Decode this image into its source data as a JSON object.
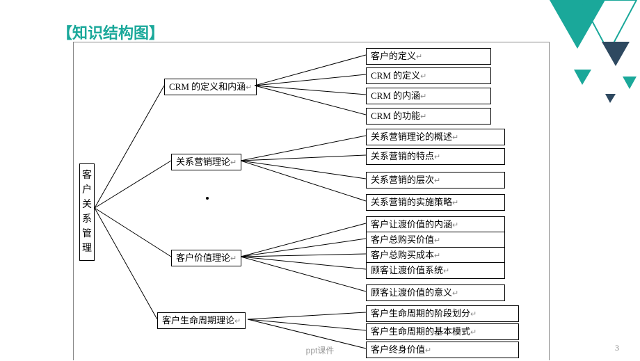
{
  "title": "【知识结构图】",
  "root": "客户关系管理",
  "branches": [
    {
      "label": "CRM 的定义和内涵",
      "leaves": [
        "客户的定义",
        "CRM 的定义",
        "CRM 的内涵",
        "CRM 的功能"
      ]
    },
    {
      "label": "关系营销理论",
      "leaves": [
        "关系营销理论的概述",
        "关系营销的特点",
        "关系营销的层次",
        "关系营销的实施策略"
      ]
    },
    {
      "label": "客户价值理论",
      "leaves": [
        "客户让渡价值的内涵",
        "客户总购买价值",
        "客户总购买成本",
        "顾客让渡价值系统",
        "顾客让渡价值的意义"
      ]
    },
    {
      "label": "客户生命周期理论",
      "leaves": [
        "客户生命周期的阶段划分",
        "客户生命周期的基本模式",
        "客户终身价值"
      ]
    }
  ],
  "footer": "ppt课件",
  "page_number": "3",
  "chart_data": {
    "type": "table",
    "title": "知识结构图 — 客户关系管理",
    "structure": "hierarchical tree",
    "root": "客户关系管理",
    "children": [
      {
        "node": "CRM 的定义和内涵",
        "children": [
          "客户的定义",
          "CRM 的定义",
          "CRM 的内涵",
          "CRM 的功能"
        ]
      },
      {
        "node": "关系营销理论",
        "children": [
          "关系营销理论的概述",
          "关系营销的特点",
          "关系营销的层次",
          "关系营销的实施策略"
        ]
      },
      {
        "node": "客户价值理论",
        "children": [
          "客户让渡价值的内涵",
          "客户总购买价值",
          "客户总购买成本",
          "顾客让渡价值系统",
          "顾客让渡价值的意义"
        ]
      },
      {
        "node": "客户生命周期理论",
        "children": [
          "客户生命周期的阶段划分",
          "客户生命周期的基本模式",
          "客户终身价值"
        ]
      }
    ]
  }
}
